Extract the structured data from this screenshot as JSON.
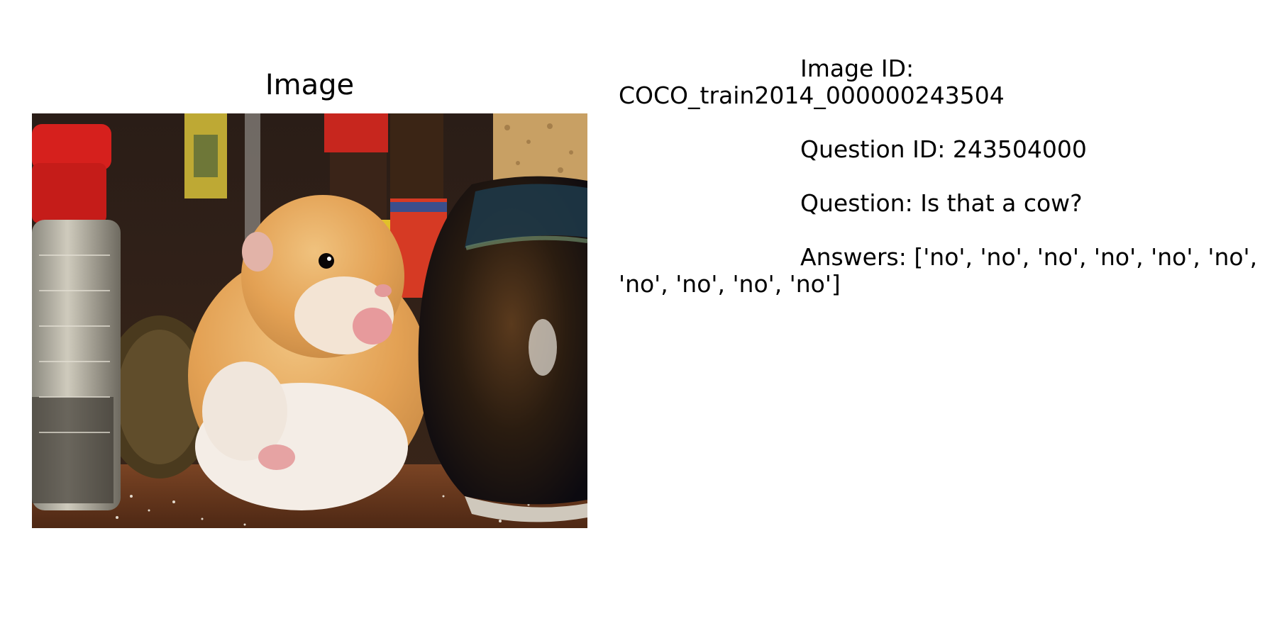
{
  "panel": {
    "title": "Image"
  },
  "photo": {
    "subject": "hamster",
    "colors": {
      "lid_red": "#d6201d",
      "fur_orange": "#e7a75e",
      "fur_white": "#f4ede6",
      "jar_dark": "#1e1810",
      "cork": "#c8a064",
      "table": "#6b3a1f"
    }
  },
  "info": {
    "image_id_label": "Image ID:",
    "image_id_value": "COCO_train2014_000000243504",
    "question_id_label": "Question ID:",
    "question_id_value": "243504000",
    "question_label": "Question:",
    "question_value": "Is that a cow?",
    "answers_label": "Answers:",
    "answers_line1": "['no', 'no', 'no', 'no', 'no', 'no',",
    "answers_line2": "'no', 'no', 'no', 'no']"
  }
}
